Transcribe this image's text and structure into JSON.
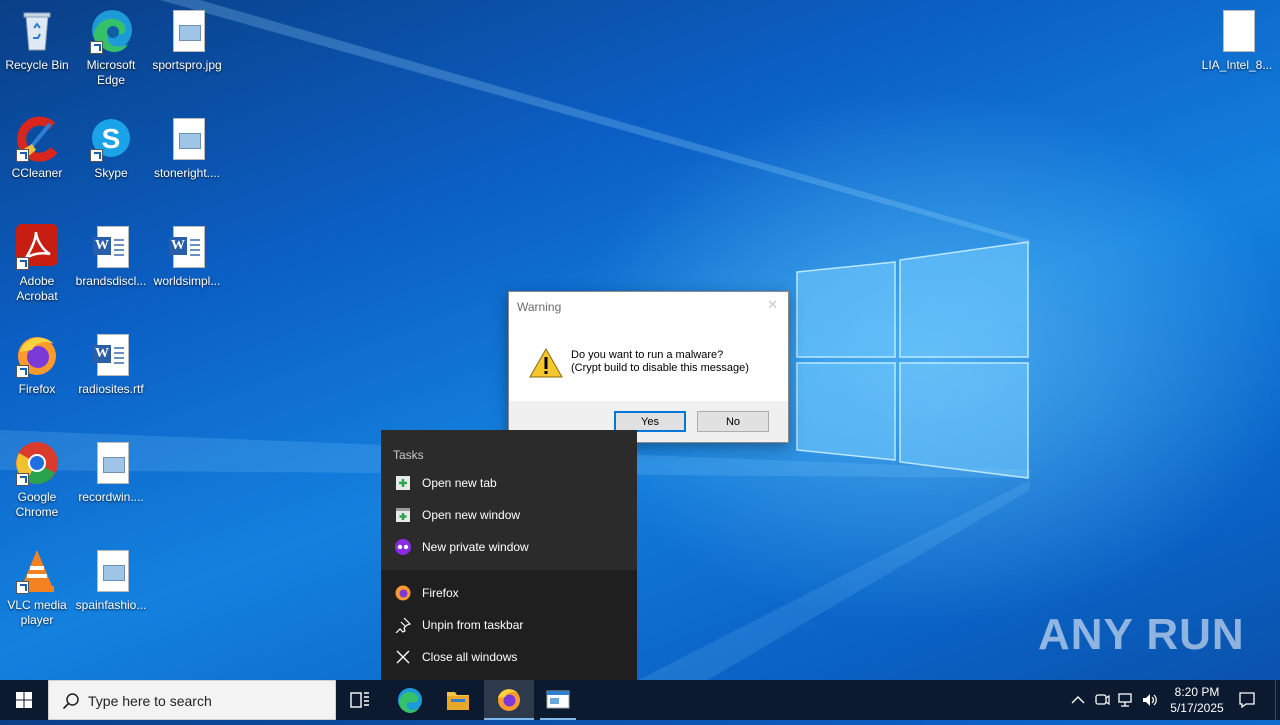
{
  "desktop_icons": [
    {
      "label": "Recycle Bin",
      "icon": "recycle-bin-icon"
    },
    {
      "label": "Microsoft Edge",
      "icon": "edge-icon"
    },
    {
      "label": "sportspro.jpg",
      "icon": "image-file-icon"
    },
    {
      "label": "CCleaner",
      "icon": "ccleaner-icon"
    },
    {
      "label": "Skype",
      "icon": "skype-icon"
    },
    {
      "label": "stoneright....",
      "icon": "image-file-icon"
    },
    {
      "label": "Adobe Acrobat",
      "icon": "acrobat-icon"
    },
    {
      "label": "brandsdiscl...",
      "icon": "word-file-icon"
    },
    {
      "label": "worldsimpl...",
      "icon": "word-file-icon"
    },
    {
      "label": "Firefox",
      "icon": "firefox-icon"
    },
    {
      "label": "radiosites.rtf",
      "icon": "word-file-icon"
    },
    {
      "label": "Google Chrome",
      "icon": "chrome-icon"
    },
    {
      "label": "recordwin....",
      "icon": "image-file-icon"
    },
    {
      "label": "VLC media player",
      "icon": "vlc-icon"
    },
    {
      "label": "spainfashio...",
      "icon": "image-file-icon"
    },
    {
      "label": "LIA_Intel_8...",
      "icon": "blank-file-icon"
    }
  ],
  "dialog": {
    "title": "Warning",
    "close": "✕",
    "line1": "Do you want to run a malware?",
    "line2": "(Crypt build to disable this message)",
    "yes": "Yes",
    "no": "No"
  },
  "jumplist": {
    "header": "Tasks",
    "tasks": [
      "Open new tab",
      "Open new window",
      "New private window"
    ],
    "app": "Firefox",
    "unpin": "Unpin from taskbar",
    "close_all": "Close all windows"
  },
  "taskbar": {
    "search_placeholder": "Type here to search",
    "time": "8:20 PM",
    "date": "5/17/2025"
  },
  "watermark": "ANY RUN",
  "colors": {
    "accent": "#0078d7",
    "taskbar": "#0b1a2e",
    "jumplist": "#2b2b2b"
  }
}
